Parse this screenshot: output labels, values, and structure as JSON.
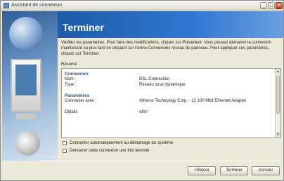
{
  "window": {
    "title": "Assistant de connexion",
    "controls": {
      "minimize": "_",
      "maximize": "□",
      "close": "✕"
    }
  },
  "header": {
    "title": "Terminer"
  },
  "intro_text": "Vérifiez les paramètres. Pour faire des modifications, cliquez sur Précédent. Vous pouvez démarrer la connexion maintenant ou plus tard en cliquant sur l'icône Connexions réseau du panneau. Pour appliquer ces paramètres, cliquez sur Terminer.",
  "summary_label": "Résumé",
  "summary": {
    "connexion_heading": "Connexion",
    "rows_connexion": [
      {
        "key": "Nom :",
        "value": "DSL Connection"
      },
      {
        "key": "Type :",
        "value": "Réseau local dynamique"
      }
    ],
    "parametres_heading": "Paramètres",
    "rows_parametres": [
      {
        "key": "Connecter avec :",
        "value": "Atheros Technology Corp. - 12 100 Mbit Ethernet Adapter"
      },
      {
        "key": "Détails",
        "value": "eth0"
      }
    ]
  },
  "checkboxes": {
    "auto_connect": "Connecter automatiquement au démarrage du système",
    "start_now": "Démarrer cette connexion une fois terminé"
  },
  "buttons": {
    "back": "<Retour",
    "finish": "Terminer",
    "cancel": "Annuler"
  }
}
